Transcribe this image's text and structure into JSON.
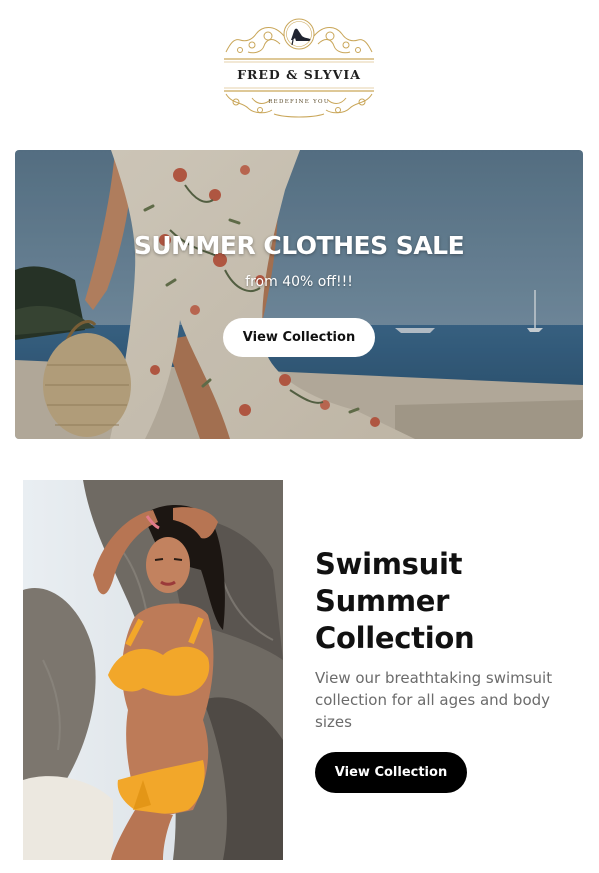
{
  "brand": {
    "name": "FRED & SLYVIA",
    "tagline": "REDEFINE YOU",
    "logo_icon": "high-heel-shoe-icon",
    "gold": "#c9a659"
  },
  "hero": {
    "title": "SUMMER CLOTHES SALE",
    "subtitle": "from 40% off!!!",
    "button_label": "View Collection"
  },
  "swimsuit": {
    "title_lines": [
      "Swimsuit",
      "Summer",
      "Collection"
    ],
    "description": "View our breathtaking swimsuit collection for all ages and body sizes",
    "button_label": "View Collection"
  }
}
